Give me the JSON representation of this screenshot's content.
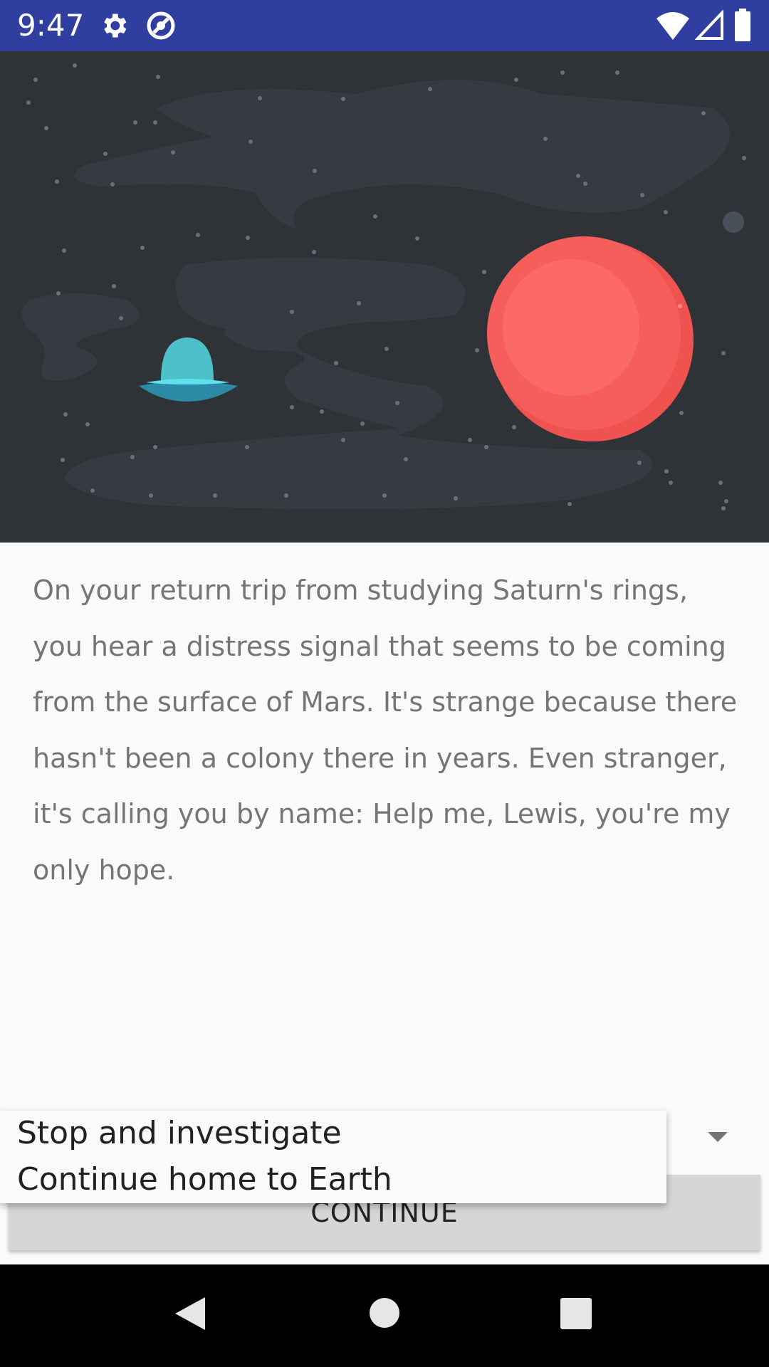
{
  "status_bar": {
    "time": "9:47",
    "icons": [
      "gear-icon",
      "data-saver-icon",
      "wifi-icon",
      "cellular-signal-icon",
      "battery-icon"
    ],
    "background": "#303f9f"
  },
  "hero": {
    "background": "#2f3237",
    "icons": [
      "ufo-icon",
      "planet-mars-icon",
      "small-moon-icon"
    ]
  },
  "story": {
    "text": "On your return trip from studying Saturn's rings, you hear a distress signal that seems to be coming from the surface of Mars. It's strange because there hasn't been a colony there in years. Even stranger, it's calling you by name: Help me, Lewis, you're my only hope."
  },
  "choice_spinner": {
    "options": [
      "Stop and investigate",
      "Continue home to Earth"
    ]
  },
  "continue_button": {
    "label": "CONTINUE"
  },
  "nav_bar": {
    "icons": [
      "back-icon",
      "home-icon",
      "recents-icon"
    ]
  }
}
